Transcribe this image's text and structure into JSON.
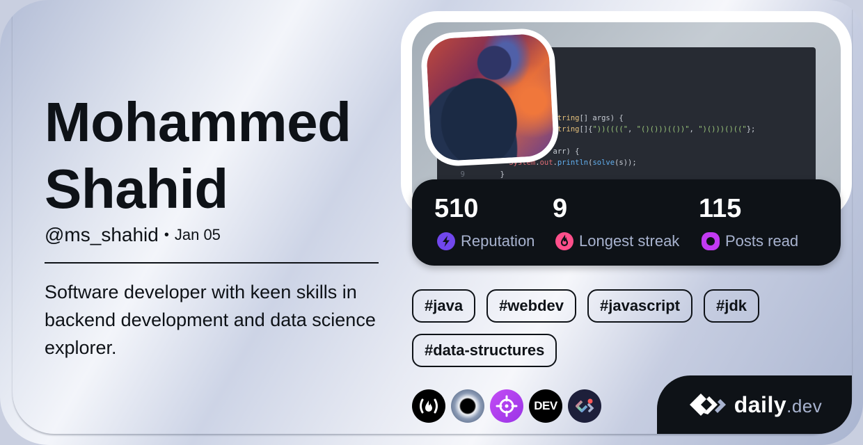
{
  "profile": {
    "name": "Mohammed Shahid",
    "handle": "@ms_shahid",
    "separator": "•",
    "joined": "Jan 05",
    "bio": "Software developer with keen skills in backend development and data science explorer."
  },
  "cover": {
    "code_lines": [
      {
        "num": "",
        "text": ""
      },
      {
        "num": "",
        "text": "oid main(String[] args) {"
      },
      {
        "num": "",
        "text": "r = new String[]{\"))((((\", \"()()))(())\", \")()))()((\"};"
      },
      {
        "num": "",
        "text": ""
      },
      {
        "num": "",
        "text": "ing s : arr) {"
      },
      {
        "num": "",
        "text": "System.out.println(solve(s));"
      },
      {
        "num": "9",
        "text": "}"
      }
    ]
  },
  "stats": [
    {
      "value": "510",
      "label": "Reputation",
      "icon": "lightning-icon",
      "color": "#7147ed"
    },
    {
      "value": "9",
      "label": "Longest streak",
      "icon": "flame-icon",
      "color": "#ff4f8b"
    },
    {
      "value": "115",
      "label": "Posts read",
      "icon": "eye-ring-icon",
      "color": "#c33af2"
    }
  ],
  "tags": [
    "#java",
    "#webdev",
    "#javascript",
    "#jdk",
    "#data-structures"
  ],
  "sources": [
    {
      "name": "freecodecamp",
      "icon": "flame-brackets-icon",
      "label": "(🔥)"
    },
    {
      "name": "eclipse",
      "icon": "eclipse-icon"
    },
    {
      "name": "target",
      "icon": "crosshair-icon"
    },
    {
      "name": "dev-to",
      "icon": "dev-icon",
      "label": "DEV"
    },
    {
      "name": "daily-dev-squad",
      "icon": "daily-dev-icon"
    }
  ],
  "brand": {
    "name": "daily",
    "tld": ".dev"
  },
  "colors": {
    "dark": "#0e1217",
    "label": "#a8b3cf"
  }
}
